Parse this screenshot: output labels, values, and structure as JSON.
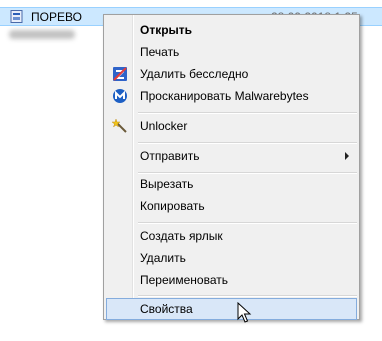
{
  "file_row": {
    "name": "ПОРЕВО",
    "date": "28.09.2018 1:25"
  },
  "menu": {
    "items": [
      {
        "label": "Открыть"
      },
      {
        "label": "Печать"
      },
      {
        "label": "Удалить бесследно",
        "icon": "z-shredder-icon"
      },
      {
        "label": "Просканировать Malwarebytes",
        "icon": "malwarebytes-icon"
      },
      {
        "label": "Unlocker",
        "icon": "unlocker-wand-icon"
      },
      {
        "label": "Отправить"
      },
      {
        "label": "Вырезать"
      },
      {
        "label": "Копировать"
      },
      {
        "label": "Создать ярлык"
      },
      {
        "label": "Удалить"
      },
      {
        "label": "Переименовать"
      },
      {
        "label": "Свойства"
      }
    ]
  },
  "colors": {
    "selection": "#cce8ff",
    "menu_bg": "#f0f0f0",
    "hover_bg": "#d9e7f8",
    "hover_border": "#84acdd"
  }
}
